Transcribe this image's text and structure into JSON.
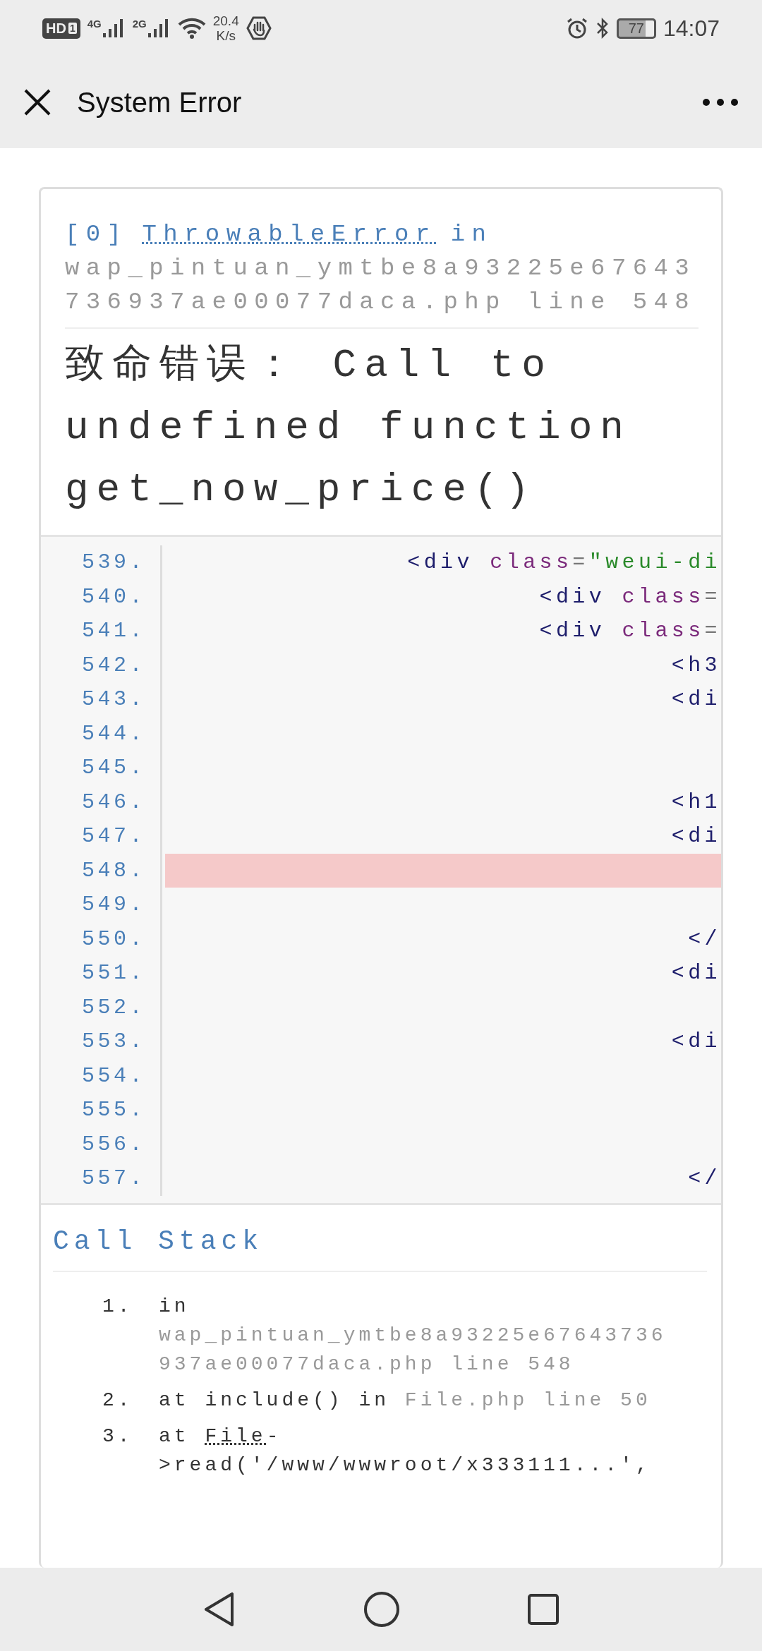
{
  "status_bar": {
    "hd": "HD",
    "sim": "1",
    "networks": [
      "4G",
      "2G"
    ],
    "speed_value": "20.4",
    "speed_unit": "K/s",
    "battery": "77",
    "time": "14:07"
  },
  "title_bar": {
    "title": "System Error"
  },
  "error": {
    "index": "[0]",
    "exception": "ThrowableError",
    "connector": "in",
    "file": "wap_pintuan_ymtbe8a93225e67643736937ae00077daca.php line 548",
    "message": "致命错误： Call to undefined function get_now_price()"
  },
  "source": {
    "lines": [
      {
        "number": "539.",
        "highlighted": false,
        "tokens": [
          {
            "kind": "tag",
            "text": "<div"
          },
          {
            "kind": "attr",
            "text": " class"
          },
          {
            "kind": "punct",
            "text": "="
          },
          {
            "kind": "string",
            "text": "\"weui-di"
          }
        ]
      },
      {
        "number": "540.",
        "highlighted": false,
        "tokens": [
          {
            "kind": "tag",
            "text": "<div"
          },
          {
            "kind": "attr",
            "text": " class"
          },
          {
            "kind": "punct",
            "text": "="
          }
        ]
      },
      {
        "number": "541.",
        "highlighted": false,
        "tokens": [
          {
            "kind": "tag",
            "text": "<div"
          },
          {
            "kind": "attr",
            "text": " class"
          },
          {
            "kind": "punct",
            "text": "="
          }
        ]
      },
      {
        "number": "542.",
        "highlighted": false,
        "tokens": [
          {
            "kind": "tag",
            "text": "<h3"
          }
        ]
      },
      {
        "number": "543.",
        "highlighted": false,
        "tokens": [
          {
            "kind": "tag",
            "text": "<di"
          }
        ]
      },
      {
        "number": "544.",
        "highlighted": false
      },
      {
        "number": "545.",
        "highlighted": false
      },
      {
        "number": "546.",
        "highlighted": false,
        "tokens": [
          {
            "kind": "tag",
            "text": "<h1"
          }
        ]
      },
      {
        "number": "547.",
        "highlighted": false,
        "tokens": [
          {
            "kind": "tag",
            "text": "<di"
          }
        ]
      },
      {
        "number": "548.",
        "highlighted": true
      },
      {
        "number": "549.",
        "highlighted": false
      },
      {
        "number": "550.",
        "highlighted": false,
        "tokens": [
          {
            "kind": "tag",
            "text": "</"
          }
        ]
      },
      {
        "number": "551.",
        "highlighted": false,
        "tokens": [
          {
            "kind": "tag",
            "text": "<di"
          }
        ]
      },
      {
        "number": "552.",
        "highlighted": false
      },
      {
        "number": "553.",
        "highlighted": false,
        "tokens": [
          {
            "kind": "tag",
            "text": "<di"
          }
        ]
      },
      {
        "number": "554.",
        "highlighted": false
      },
      {
        "number": "555.",
        "highlighted": false
      },
      {
        "number": "556.",
        "highlighted": false
      },
      {
        "number": "557.",
        "highlighted": false,
        "tokens": [
          {
            "kind": "tag",
            "text": "</"
          }
        ]
      }
    ]
  },
  "call_stack": {
    "title": "Call Stack",
    "items": [
      {
        "number": "1.",
        "parts": [
          {
            "kind": "plain",
            "text": "in "
          },
          {
            "kind": "file",
            "text": "wap_pintuan_ymtbe8a93225e67643736937ae00077daca.php line 548"
          }
        ]
      },
      {
        "number": "2.",
        "parts": [
          {
            "kind": "plain",
            "text": "at include() in "
          },
          {
            "kind": "file",
            "text": "File.php line 50"
          }
        ]
      },
      {
        "number": "3.",
        "parts": [
          {
            "kind": "plain",
            "text": "at "
          },
          {
            "kind": "abbr",
            "text": "File"
          },
          {
            "kind": "plain",
            "text": "->read('/www/wwwroot/x333111...',"
          }
        ]
      }
    ]
  }
}
